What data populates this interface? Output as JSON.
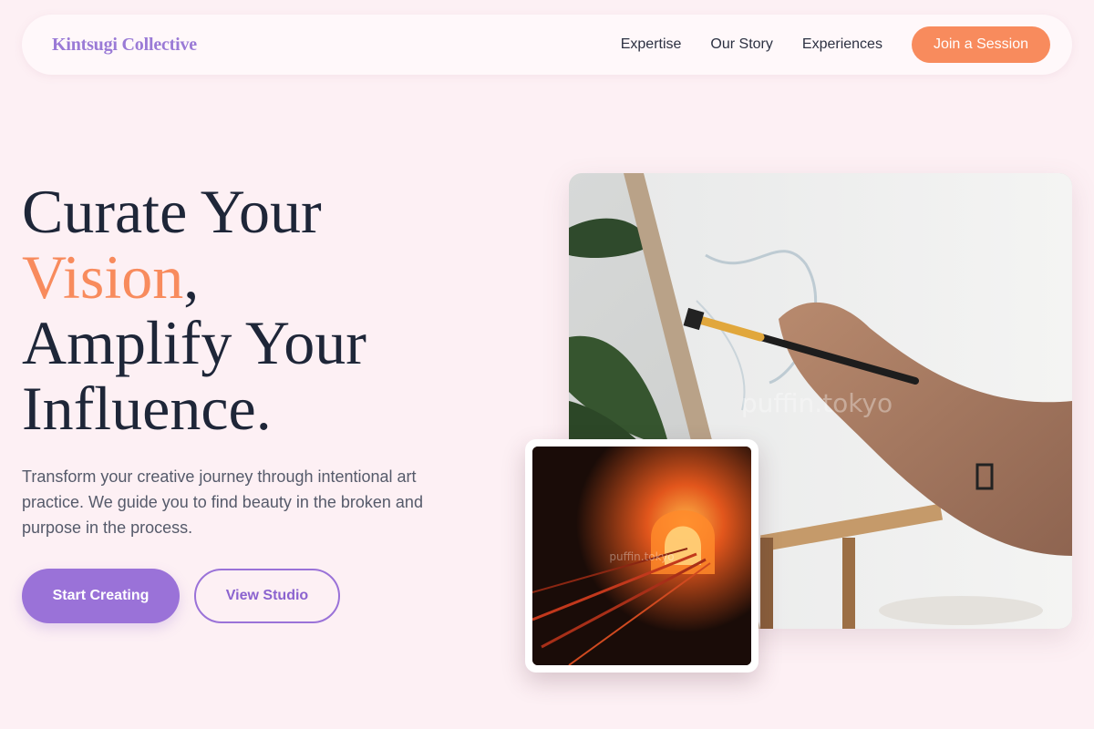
{
  "nav": {
    "brand": "Kintsugi Collective",
    "links": [
      "Expertise",
      "Our Story",
      "Experiences"
    ],
    "cta": "Join a Session"
  },
  "hero": {
    "headline_line1": "Curate Your",
    "headline_accent": "Vision",
    "headline_comma": ",",
    "headline_line3": "Amplify Your",
    "headline_line4": "Influence.",
    "subtext": "Transform your creative journey through intentional art practice. We guide you to find beauty in the broken and purpose in the process.",
    "primary_button": "Start Creating",
    "secondary_button": "View Studio"
  },
  "images": {
    "main_watermark": "puffin.tokyo",
    "inset_watermark": "puffin.tokyo"
  },
  "colors": {
    "background": "#fdf0f4",
    "accent_orange": "#f88b5d",
    "accent_purple": "#9a72d8",
    "text_dark": "#1e2638"
  }
}
